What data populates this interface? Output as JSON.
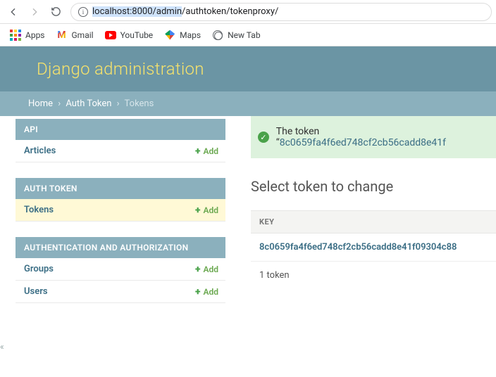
{
  "browser": {
    "address_selected": "localhost:8000/admin",
    "address_rest": "/authtoken/tokenproxy/",
    "bookmarks": {
      "apps": "Apps",
      "gmail": "Gmail",
      "youtube": "YouTube",
      "maps": "Maps",
      "newtab": "New Tab"
    }
  },
  "header": {
    "title": "Django administration"
  },
  "breadcrumbs": {
    "home": "Home",
    "section": "Auth Token",
    "current": "Tokens"
  },
  "sidebar": {
    "add_label": "Add",
    "modules": [
      {
        "caption": "API",
        "rows": [
          {
            "label": "Articles"
          }
        ]
      },
      {
        "caption": "AUTH TOKEN",
        "rows": [
          {
            "label": "Tokens",
            "highlight": true
          }
        ]
      },
      {
        "caption": "AUTHENTICATION AND AUTHORIZATION",
        "rows": [
          {
            "label": "Groups"
          },
          {
            "label": "Users"
          }
        ]
      }
    ]
  },
  "flash": {
    "prefix": "The token “",
    "token": "8c0659fa4f6ed748cf2cb56cadd8e41f"
  },
  "content": {
    "heading": "Select token to change",
    "column": "KEY",
    "rows": [
      {
        "key": "8c0659fa4f6ed748cf2cb56cadd8e41f09304c88"
      }
    ],
    "count": "1 token"
  },
  "collapse_glyph": "«"
}
